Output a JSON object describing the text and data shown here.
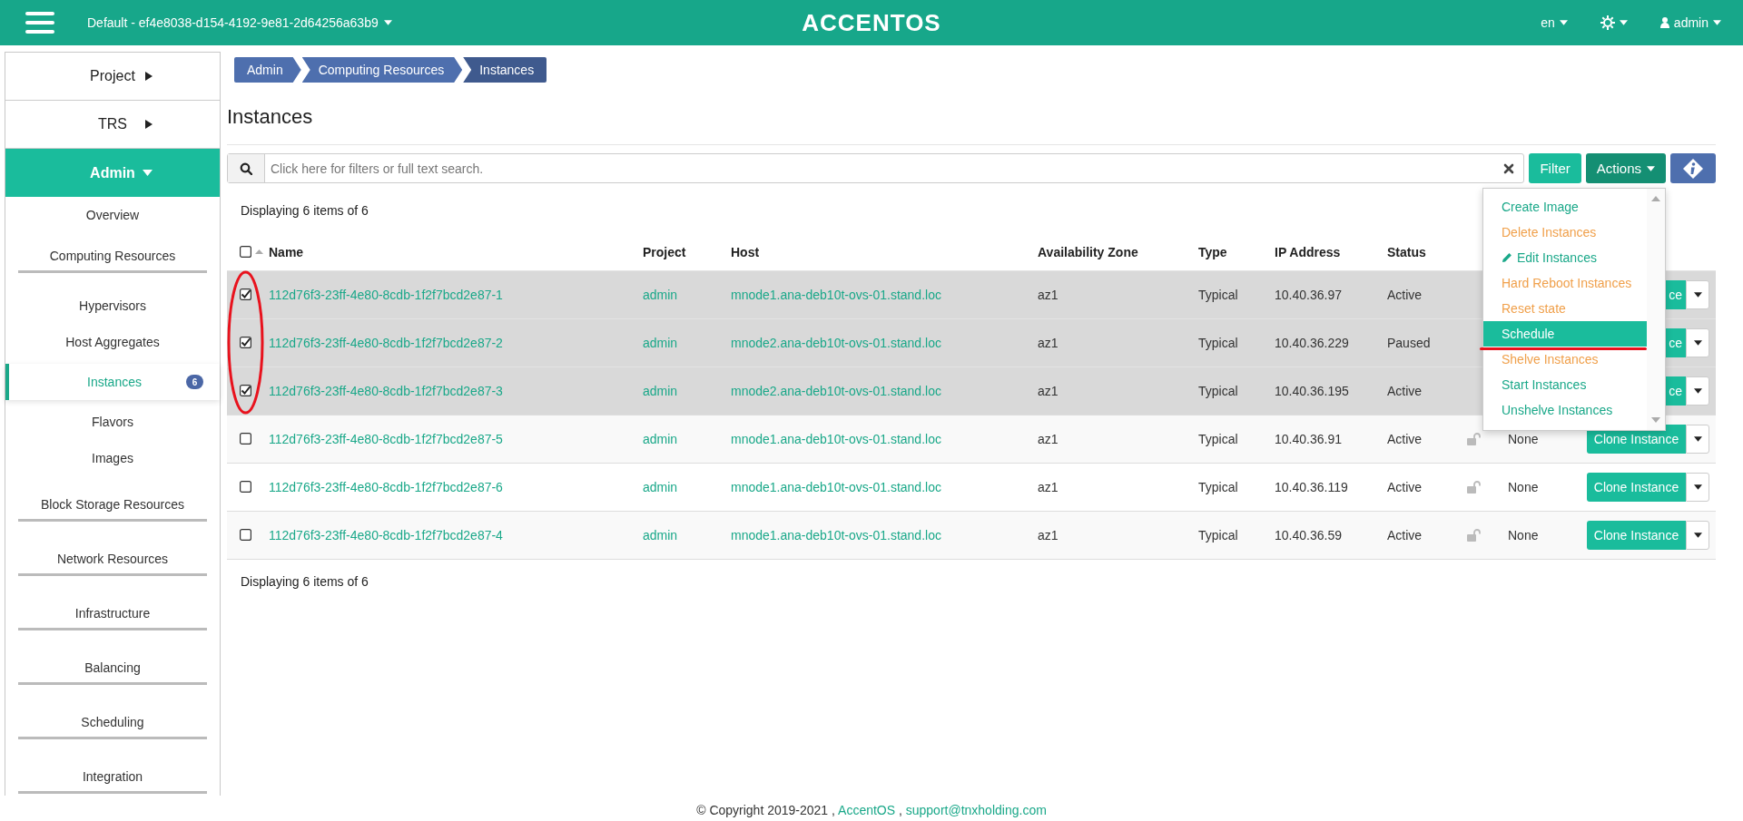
{
  "header": {
    "project": "Default - ef4e8038-d154-4192-9e81-2d64256a63b9",
    "logo": "ACCENTOS",
    "language": "en",
    "user": "admin"
  },
  "sidebar": {
    "items": [
      {
        "label": "Project",
        "expanded": false
      },
      {
        "label": "TRS",
        "expanded": false
      },
      {
        "label": "Admin",
        "expanded": true,
        "children": [
          {
            "kind": "link",
            "label": "Overview",
            "selected": false
          },
          {
            "kind": "group",
            "label": "Computing Resources",
            "children": [
              {
                "kind": "link",
                "label": "Hypervisors",
                "selected": false
              },
              {
                "kind": "link",
                "label": "Host Aggregates",
                "selected": false
              },
              {
                "kind": "link",
                "label": "Instances",
                "selected": true,
                "badge": "6"
              },
              {
                "kind": "link",
                "label": "Flavors",
                "selected": false
              },
              {
                "kind": "link",
                "label": "Images",
                "selected": false
              }
            ]
          },
          {
            "kind": "group",
            "label": "Block Storage Resources"
          },
          {
            "kind": "group",
            "label": "Network Resources"
          },
          {
            "kind": "group",
            "label": "Infrastructure"
          },
          {
            "kind": "group",
            "label": "Balancing"
          },
          {
            "kind": "group",
            "label": "Scheduling"
          },
          {
            "kind": "group",
            "label": "Integration"
          }
        ]
      }
    ]
  },
  "breadcrumb": [
    "Admin",
    "Computing Resources",
    "Instances"
  ],
  "page_title": "Instances",
  "search": {
    "placeholder": "Click here for filters or full text search."
  },
  "buttons": {
    "filter": "Filter",
    "actions": "Actions"
  },
  "actions_menu": {
    "open": true,
    "items": [
      {
        "label": "Create Image",
        "kind": "normal",
        "selected": false
      },
      {
        "label": "Delete Instances",
        "kind": "danger",
        "selected": false
      },
      {
        "label": "Edit Instances",
        "kind": "edit",
        "selected": false
      },
      {
        "label": "Hard Reboot Instances",
        "kind": "danger",
        "selected": false
      },
      {
        "label": "Reset state",
        "kind": "danger",
        "selected": false
      },
      {
        "label": "Schedule",
        "kind": "normal",
        "selected": true
      },
      {
        "label": "Shelve Instances",
        "kind": "danger",
        "selected": false
      },
      {
        "label": "Start Instances",
        "kind": "normal",
        "selected": false
      },
      {
        "label": "Unshelve Instances",
        "kind": "normal",
        "selected": false
      }
    ]
  },
  "count_top": "Displaying 6 items of 6",
  "table": {
    "select_all": false,
    "columns": [
      "Name",
      "Project",
      "Host",
      "Availability Zone",
      "Type",
      "IP Address",
      "Status"
    ],
    "rows": [
      {
        "selected": true,
        "name": "112d76f3-23ff-4e80-8cdb-1f2f7bcd2e87-1",
        "project": "admin",
        "host": "mnode1.ana-deb10t-ovs-01.stand.loc",
        "zone": "az1",
        "type": "Typical",
        "ip": "10.40.36.97",
        "status": "Active",
        "action": "ce"
      },
      {
        "selected": true,
        "name": "112d76f3-23ff-4e80-8cdb-1f2f7bcd2e87-2",
        "project": "admin",
        "host": "mnode2.ana-deb10t-ovs-01.stand.loc",
        "zone": "az1",
        "type": "Typical",
        "ip": "10.40.36.229",
        "status": "Paused",
        "action": "ce"
      },
      {
        "selected": true,
        "name": "112d76f3-23ff-4e80-8cdb-1f2f7bcd2e87-3",
        "project": "admin",
        "host": "mnode2.ana-deb10t-ovs-01.stand.loc",
        "zone": "az1",
        "type": "Typical",
        "ip": "10.40.36.195",
        "status": "Active",
        "action": "ce"
      },
      {
        "selected": false,
        "name": "112d76f3-23ff-4e80-8cdb-1f2f7bcd2e87-5",
        "project": "admin",
        "host": "mnode1.ana-deb10t-ovs-01.stand.loc",
        "zone": "az1",
        "type": "Typical",
        "ip": "10.40.36.91",
        "status": "Active",
        "locked": false,
        "power": "None",
        "action": "Clone Instance"
      },
      {
        "selected": false,
        "name": "112d76f3-23ff-4e80-8cdb-1f2f7bcd2e87-6",
        "project": "admin",
        "host": "mnode1.ana-deb10t-ovs-01.stand.loc",
        "zone": "az1",
        "type": "Typical",
        "ip": "10.40.36.119",
        "status": "Active",
        "locked": false,
        "power": "None",
        "action": "Clone Instance"
      },
      {
        "selected": false,
        "name": "112d76f3-23ff-4e80-8cdb-1f2f7bcd2e87-4",
        "project": "admin",
        "host": "mnode1.ana-deb10t-ovs-01.stand.loc",
        "zone": "az1",
        "type": "Typical",
        "ip": "10.40.36.59",
        "status": "Active",
        "locked": false,
        "power": "None",
        "action": "Clone Instance"
      }
    ]
  },
  "count_bottom": "Displaying 6 items of 6",
  "footer": [
    {
      "kind": "text",
      "text": "© Copyright 2019-2021 ,"
    },
    {
      "kind": "link",
      "text": "AccentOS"
    },
    {
      "kind": "text",
      "text": ","
    },
    {
      "kind": "link",
      "text": "support@tnxholding.com"
    }
  ]
}
